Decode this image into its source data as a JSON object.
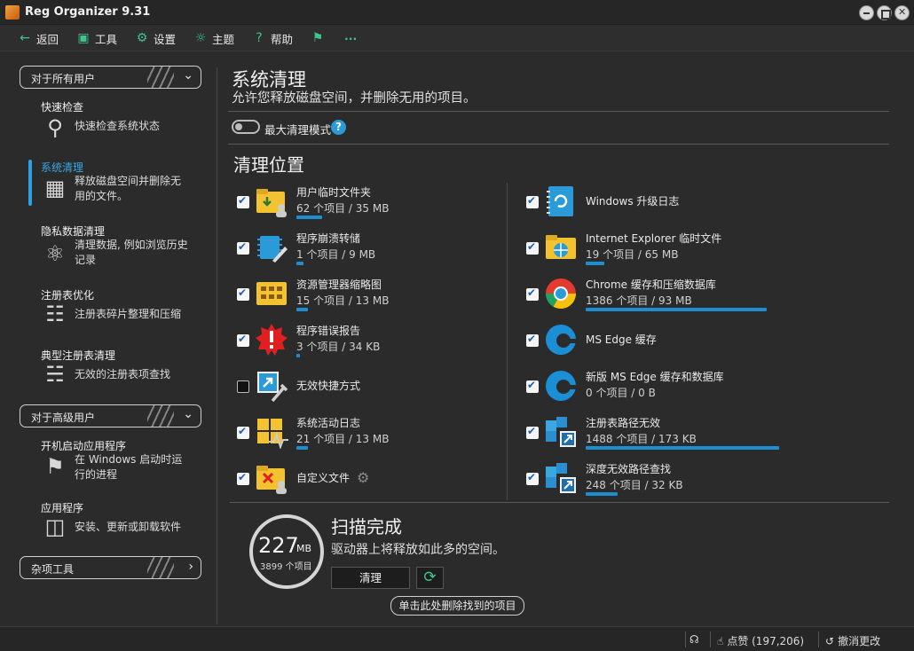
{
  "window": {
    "title": "Reg Organizer 9.31"
  },
  "toolbar": {
    "back": "返回",
    "tools": "工具",
    "settings": "设置",
    "theme": "主题",
    "help": "帮助",
    "more": "···"
  },
  "sidebar": {
    "group_all_users": "对于所有用户",
    "group_advanced": "对于高级用户",
    "group_misc": "杂项工具",
    "items": [
      {
        "title": "快速检查",
        "desc": "快速检查系统状态"
      },
      {
        "title": "系统清理",
        "desc": "释放磁盘空间并删除无用的文件。"
      },
      {
        "title": "隐私数据清理",
        "desc": "清理数据, 例如浏览历史记录"
      },
      {
        "title": "注册表优化",
        "desc": "注册表碎片整理和压缩"
      },
      {
        "title": "典型注册表清理",
        "desc": "无效的注册表项查找"
      },
      {
        "title": "开机启动应用程序",
        "desc": "在 Windows 启动时运行的进程"
      },
      {
        "title": "应用程序",
        "desc": "安装、更新或卸载软件"
      }
    ]
  },
  "main": {
    "title": "系统清理",
    "subtitle": "允许您释放磁盘空间，并删除无用的项目。",
    "max_mode_label": "最大清理模式",
    "help_glyph": "?",
    "section_title": "清理位置",
    "left_items": [
      {
        "name": "用户临时文件夹",
        "info": "62 个项目 / 35 MB",
        "checked": true,
        "fill": 0.14
      },
      {
        "name": "程序崩溃转储",
        "info": "1 个项目 / 9 MB",
        "checked": true,
        "fill": 0.04
      },
      {
        "name": "资源管理器缩略图",
        "info": "15 个项目 / 13 MB",
        "checked": true,
        "fill": 0.06
      },
      {
        "name": "程序错误报告",
        "info": "3 个项目 / 34 KB",
        "checked": true,
        "fill": 0.02
      },
      {
        "name": "无效快捷方式",
        "info": "",
        "checked": false,
        "fill": 0
      },
      {
        "name": "系统活动日志",
        "info": "21 个项目 / 13 MB",
        "checked": true,
        "fill": 0.06
      },
      {
        "name": "自定义文件",
        "info": "",
        "checked": true,
        "fill": 0
      }
    ],
    "right_items": [
      {
        "name": "Windows 升级日志",
        "info": "",
        "checked": true,
        "fill": 0
      },
      {
        "name": "Internet Explorer 临时文件",
        "info": "19 个项目 / 65 MB",
        "checked": true,
        "fill": 0.1
      },
      {
        "name": "Chrome 缓存和压缩数据库",
        "info": "1386 个项目 / 93 MB",
        "checked": true,
        "fill": 0.97
      },
      {
        "name": "MS Edge 缓存",
        "info": "",
        "checked": true,
        "fill": 0
      },
      {
        "name": "新版 MS Edge 缓存和数据库",
        "info": "0 个项目 / 0 B",
        "checked": true,
        "fill": 0
      },
      {
        "name": "注册表路径无效",
        "info": "1488 个项目 / 173 KB",
        "checked": true,
        "fill": 1.0
      },
      {
        "name": "深度无效路径查找",
        "info": "248 个项目 / 32 KB",
        "checked": true,
        "fill": 0.17
      }
    ]
  },
  "scan": {
    "total_value": "227",
    "total_unit": "MB",
    "item_count": "3899 个项目",
    "title": "扫描完成",
    "subtitle": "驱动器上将释放如此多的空间。",
    "clean_button": "清理",
    "delete_link": "单击此处删除找到的项目"
  },
  "statusbar": {
    "likes": "点赞 (197,206)",
    "undo": "撤消更改"
  },
  "colors": {
    "accent": "#2ea0e6",
    "green": "#3ec48c",
    "background": "#2b2b2b"
  }
}
